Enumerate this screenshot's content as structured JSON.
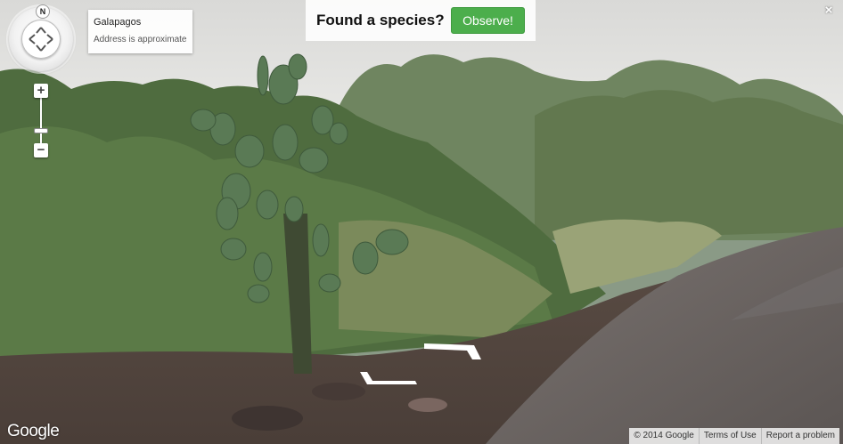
{
  "address": {
    "title": "Galapagos",
    "subtitle": "Address is approximate"
  },
  "banner": {
    "text": "Found a species?",
    "button_label": "Observe!"
  },
  "compass": {
    "north_label": "N"
  },
  "zoom": {
    "plus_label": "+",
    "minus_label": "−"
  },
  "close_label": "×",
  "logo_text": "Google",
  "footer": {
    "copyright": "© 2014 Google",
    "terms": "Terms of Use",
    "report": "Report a problem"
  },
  "colors": {
    "observe_button": "#4cae4c",
    "sky": "#e2e2e0",
    "vegetation": "#5d7a4c",
    "road": "#6b6563"
  },
  "icons": [
    "compass-icon",
    "zoom-plus-icon",
    "zoom-minus-icon",
    "close-icon",
    "navigation-arrow-icon"
  ]
}
